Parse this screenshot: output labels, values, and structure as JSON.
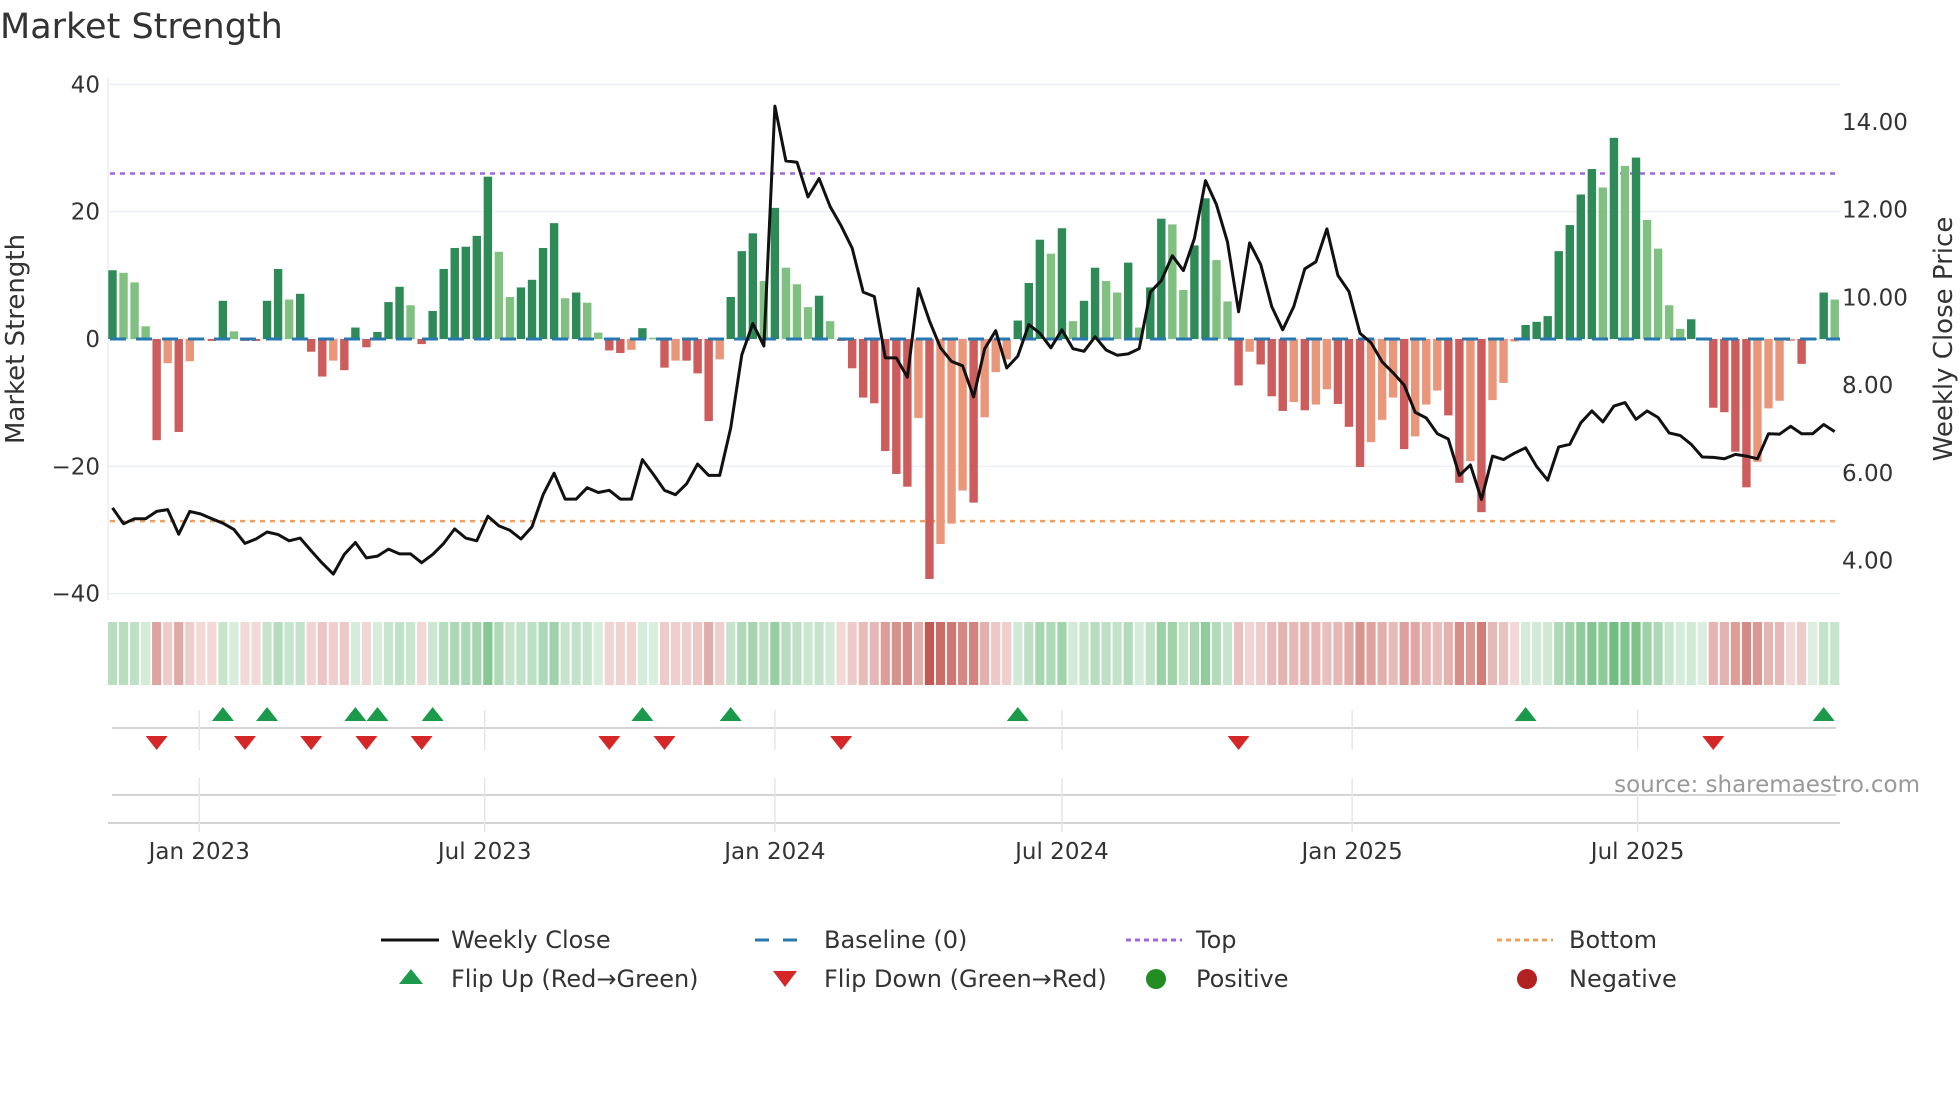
{
  "title": "Market Strength",
  "source": "source: sharemaestro.com",
  "colors": {
    "strong_green": "#2e8b57",
    "weak_green": "#80c080",
    "strong_red": "#cd5c5c",
    "weak_red": "#e9967a",
    "price": "#111111",
    "baseline": "#2878b0",
    "top": "#a066e0",
    "bottom": "#f0a05a",
    "flip_up": "#1a9a4a",
    "flip_down": "#d62728",
    "positive": "#228b22",
    "negative": "#b22222"
  },
  "legend": [
    {
      "key": "weekly_close",
      "label": "Weekly Close"
    },
    {
      "key": "baseline",
      "label": "Baseline (0)"
    },
    {
      "key": "top",
      "label": "Top"
    },
    {
      "key": "bottom",
      "label": "Bottom"
    },
    {
      "key": "flip_up",
      "label": "Flip Up (Red→Green)"
    },
    {
      "key": "flip_down",
      "label": "Flip Down (Green→Red)"
    },
    {
      "key": "positive",
      "label": "Positive"
    },
    {
      "key": "negative",
      "label": "Negative"
    }
  ],
  "chart_data": {
    "type": "bar",
    "title": "Market Strength",
    "ylabel": "Market Strength",
    "y2label": "Weekly Close Price",
    "ylim": [
      -41,
      41
    ],
    "y2lim": [
      3.1,
      15.0
    ],
    "yticks": [
      40,
      20,
      0,
      -20,
      -40
    ],
    "ytick_labels": [
      "40",
      "20",
      "0",
      "−20",
      "−40"
    ],
    "y2ticks": [
      14,
      12,
      10,
      8,
      6,
      4
    ],
    "y2tick_labels": [
      "14.00",
      "12.00",
      "10.00",
      "8.00",
      "6.00",
      "4.00"
    ],
    "xtick_labels": [
      {
        "date": "2023-01-01",
        "label": "Jan 2023"
      },
      {
        "date": "2023-07-01",
        "label": "Jul 2023"
      },
      {
        "date": "2024-01-01",
        "label": "Jan 2024"
      },
      {
        "date": "2024-07-01",
        "label": "Jul 2024"
      },
      {
        "date": "2025-01-01",
        "label": "Jan 2025"
      },
      {
        "date": "2025-07-01",
        "label": "Jul 2025"
      }
    ],
    "start_date": "2022-11-07",
    "frequency": "weekly",
    "top_level": 26.0,
    "bottom_level": -28.6,
    "baseline": 0,
    "strength": [
      10.8,
      10.4,
      8.9,
      2.0,
      -15.9,
      -3.8,
      -14.6,
      -3.5,
      -0.2,
      -0.3,
      6.0,
      1.2,
      -0.3,
      -0.3,
      6.0,
      11.0,
      6.2,
      7.1,
      -2.0,
      -5.9,
      -3.4,
      -4.9,
      1.8,
      -1.3,
      1.1,
      5.8,
      8.2,
      5.3,
      -0.8,
      4.4,
      11.0,
      14.3,
      14.5,
      16.2,
      25.5,
      13.7,
      6.6,
      8.1,
      9.3,
      14.3,
      18.2,
      6.4,
      7.3,
      5.7,
      1.0,
      -1.8,
      -2.2,
      -1.7,
      1.7,
      0.2,
      -4.5,
      -3.4,
      -3.4,
      -5.4,
      -12.9,
      -3.2,
      6.6,
      13.8,
      16.6,
      9.1,
      20.6,
      11.2,
      8.6,
      5.0,
      6.8,
      2.8,
      -0.3,
      -4.6,
      -9.2,
      -10.1,
      -17.6,
      -21.2,
      -23.2,
      -12.4,
      -37.7,
      -32.2,
      -29.0,
      -23.8,
      -25.7,
      -12.3,
      -5.2,
      -3.2,
      2.9,
      8.8,
      15.6,
      13.4,
      17.4,
      2.8,
      6.0,
      11.2,
      9.1,
      7.3,
      12.0,
      1.8,
      8.1,
      18.9,
      18.0,
      7.7,
      14.7,
      22.1,
      12.4,
      5.9,
      -7.3,
      -2.0,
      -4.0,
      -9.0,
      -11.3,
      -9.9,
      -11.2,
      -10.3,
      -7.9,
      -10.2,
      -13.8,
      -20.1,
      -16.2,
      -12.7,
      -9.2,
      -17.3,
      -15.3,
      -10.3,
      -8.1,
      -12.0,
      -22.6,
      -19.2,
      -27.2,
      -9.6,
      -6.9,
      -0.4,
      2.2,
      2.7,
      3.6,
      13.8,
      17.9,
      22.7,
      26.7,
      23.8,
      31.6,
      27.2,
      28.5,
      18.7,
      14.2,
      5.3,
      1.6,
      3.1,
      0.2,
      -10.8,
      -11.5,
      -17.7,
      -23.3,
      -19.3,
      -10.9,
      -9.7,
      -0.3,
      -3.9,
      0.1,
      7.3,
      6.2
    ],
    "weekly_close": [
      5.2,
      4.84,
      4.95,
      4.95,
      5.12,
      5.16,
      4.6,
      5.12,
      5.06,
      4.95,
      4.85,
      4.71,
      4.39,
      4.49,
      4.65,
      4.59,
      4.45,
      4.51,
      4.22,
      3.94,
      3.69,
      4.14,
      4.41,
      4.06,
      4.1,
      4.26,
      4.15,
      4.15,
      3.95,
      4.14,
      4.39,
      4.72,
      4.51,
      4.45,
      5.01,
      4.79,
      4.69,
      4.49,
      4.77,
      5.5,
      5.99,
      5.4,
      5.4,
      5.66,
      5.55,
      5.6,
      5.4,
      5.4,
      6.3,
      5.96,
      5.6,
      5.5,
      5.75,
      6.2,
      5.94,
      5.94,
      7.02,
      8.69,
      9.4,
      8.89,
      14.36,
      13.11,
      13.08,
      12.29,
      12.71,
      12.07,
      11.63,
      11.12,
      10.12,
      10.02,
      8.62,
      8.62,
      8.18,
      10.2,
      9.46,
      8.85,
      8.54,
      8.44,
      7.73,
      8.83,
      9.24,
      8.39,
      8.66,
      9.38,
      9.18,
      8.85,
      9.26,
      8.83,
      8.77,
      9.1,
      8.8,
      8.68,
      8.71,
      8.83,
      10.12,
      10.38,
      10.95,
      10.61,
      11.34,
      12.66,
      12.11,
      11.26,
      9.67,
      11.24,
      10.75,
      9.79,
      9.26,
      9.79,
      10.65,
      10.81,
      11.56,
      10.5,
      10.13,
      9.18,
      8.96,
      8.53,
      8.28,
      8.0,
      7.38,
      7.25,
      6.89,
      6.77,
      5.94,
      6.18,
      5.39,
      6.38,
      6.3,
      6.45,
      6.57,
      6.14,
      5.83,
      6.59,
      6.65,
      7.14,
      7.41,
      7.16,
      7.52,
      7.6,
      7.22,
      7.41,
      7.26,
      6.91,
      6.85,
      6.65,
      6.36,
      6.35,
      6.32,
      6.42,
      6.38,
      6.32,
      6.89,
      6.88,
      7.06,
      6.89,
      6.89,
      7.1,
      6.94
    ],
    "flip_up_weeks": [
      10,
      14,
      22,
      24,
      29,
      48,
      56,
      82,
      128,
      155
    ],
    "flip_down_weeks": [
      4,
      12,
      18,
      23,
      28,
      45,
      50,
      66,
      102,
      145
    ]
  }
}
